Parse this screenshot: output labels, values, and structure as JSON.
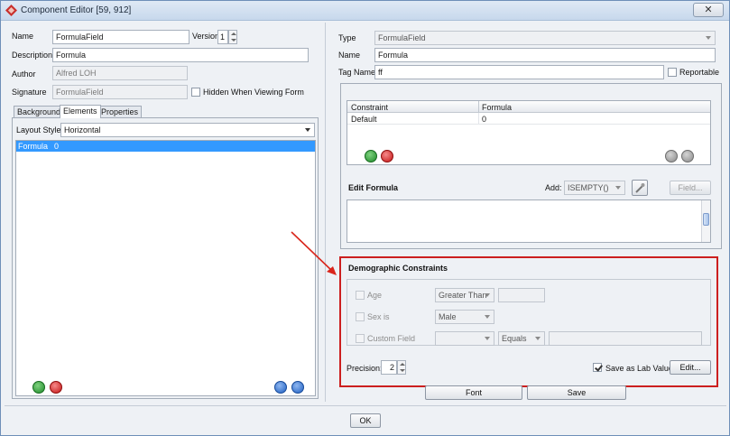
{
  "window": {
    "title": "Component Editor [59, 912]"
  },
  "left": {
    "name_label": "Name",
    "name_value": "FormulaField",
    "version_label": "Version",
    "version_value": "1",
    "description_label": "Description",
    "description_value": "Formula",
    "author_label": "Author",
    "author_value": "Alfred LOH",
    "signature_label": "Signature",
    "signature_value": "FormulaField",
    "hidden_label": "Hidden When Viewing Form",
    "tabs": [
      {
        "label": "Background"
      },
      {
        "label": "Elements"
      },
      {
        "label": "Properties"
      }
    ],
    "layout_style_label": "Layout Style",
    "layout_style_value": "Horizontal",
    "elements": [
      {
        "name": "Formula",
        "value": "0"
      }
    ]
  },
  "right": {
    "type_label": "Type",
    "type_value": "FormulaField",
    "name_label": "Name",
    "name_value": "Formula",
    "tagname_label": "Tag Name",
    "tagname_value": "ff",
    "reportable_label": "Reportable",
    "table": {
      "headers": [
        "Constraint",
        "Formula"
      ],
      "rows": [
        [
          "Default",
          "0"
        ]
      ]
    },
    "edit_formula_label": "Edit Formula",
    "add_label": "Add:",
    "add_value": "ISEMPTY()",
    "field_button": "Field...",
    "demographic": {
      "title": "Demographic Constraints",
      "age_label": "Age",
      "age_op": "Greater Than",
      "sex_label": "Sex is",
      "sex_value": "Male",
      "custom_label": "Custom Field",
      "custom_op": "Equals",
      "precision_label": "Precision:",
      "precision_value": "2",
      "save_lab_label": "Save as Lab Value",
      "edit_button": "Edit..."
    },
    "font_button": "Font",
    "save_button": "Save"
  },
  "footer": {
    "ok_button": "OK"
  },
  "colors": {
    "highlight_box": "#cc1f1f",
    "selection": "#3399ff",
    "arrow": "#d9261c"
  }
}
